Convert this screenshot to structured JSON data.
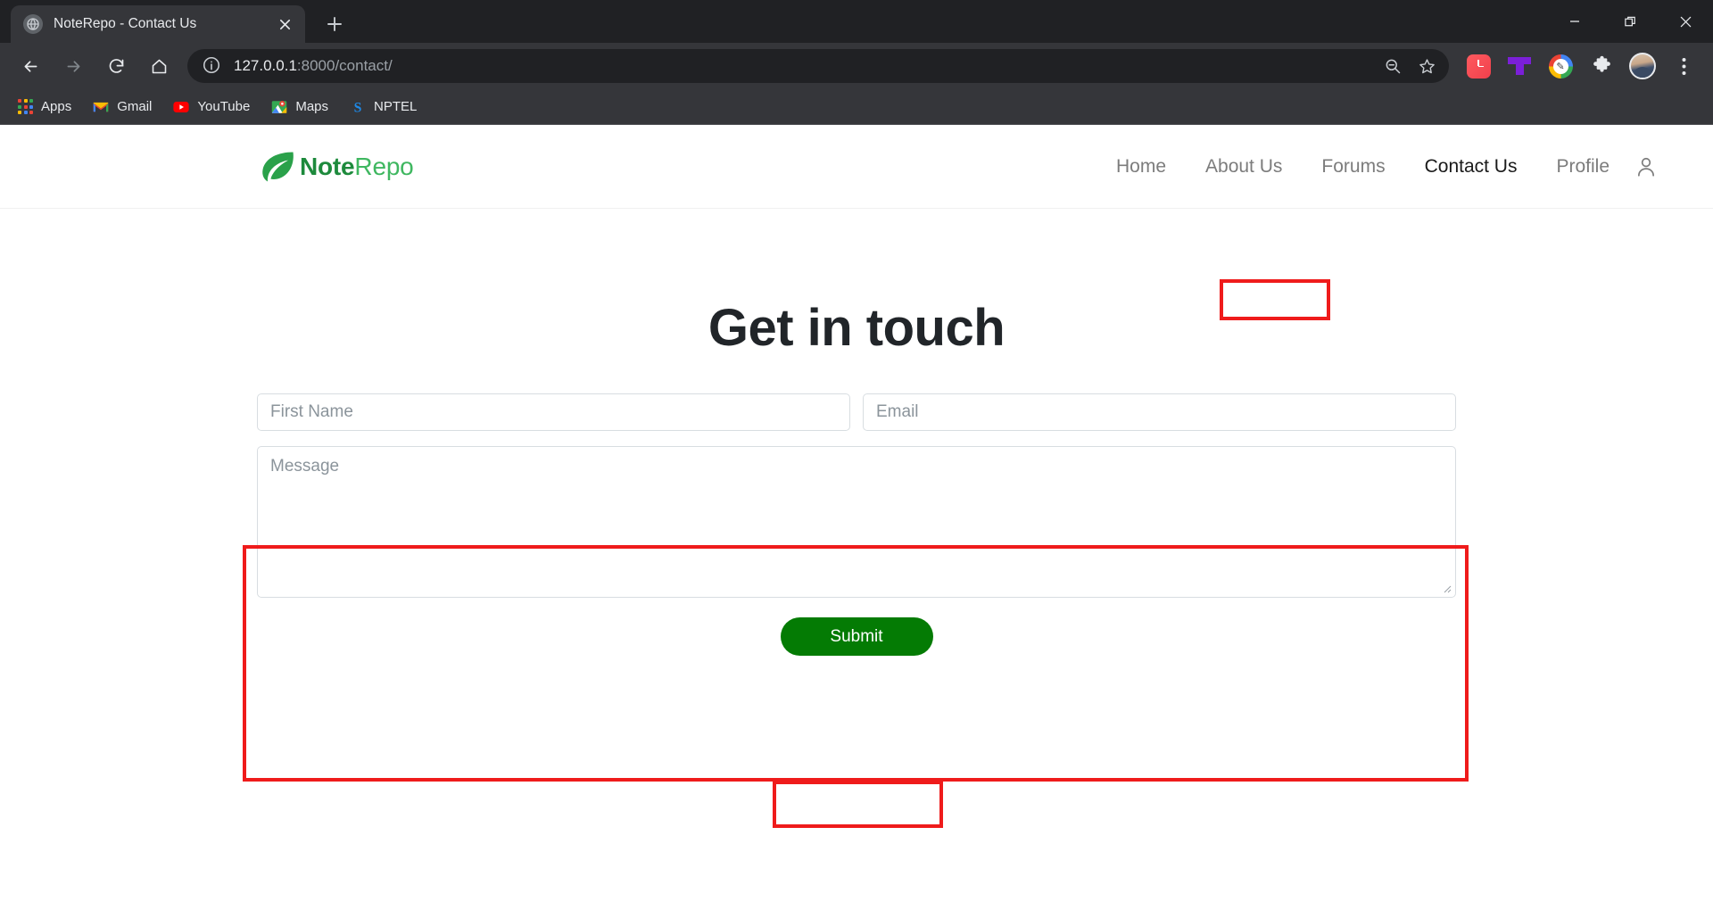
{
  "browser": {
    "tab": {
      "title": "NoteRepo - Contact Us",
      "favicon_icon": "globe-icon",
      "close_icon": "close-icon"
    },
    "new_tab_icon": "plus-icon",
    "window_controls": {
      "minimize_icon": "minimize-icon",
      "maximize_icon": "restore-window-icon",
      "close_icon": "close-icon"
    },
    "toolbar": {
      "back_icon": "back-arrow-icon",
      "forward_icon": "forward-arrow-icon",
      "reload_icon": "reload-icon",
      "home_icon": "home-icon",
      "site_info_icon": "info-circle-icon",
      "url_host": "127.0.0.1",
      "url_path": ":8000/contact/",
      "zoom_out_icon": "zoom-out-icon",
      "bookmark_icon": "star-icon",
      "extension_clock_icon": "clock-extension-icon",
      "extension_t_icon": "purple-t-extension-icon",
      "extension_pencil_icon": "google-pencil-extension-icon",
      "extensions_icon": "puzzle-piece-icon",
      "profile_avatar_icon": "avatar",
      "menu_icon": "three-dot-menu-icon"
    },
    "bookmarks": [
      {
        "label": "Apps",
        "icon": "apps-grid-icon"
      },
      {
        "label": "Gmail",
        "icon": "gmail-icon"
      },
      {
        "label": "YouTube",
        "icon": "youtube-icon"
      },
      {
        "label": "Maps",
        "icon": "google-maps-icon"
      },
      {
        "label": "NPTEL",
        "icon": "nptel-icon"
      }
    ]
  },
  "site": {
    "logo": {
      "icon": "leaf-icon",
      "text_primary": "Note",
      "text_secondary": "Repo"
    },
    "nav": [
      {
        "label": "Home",
        "active": false
      },
      {
        "label": "About Us",
        "active": false
      },
      {
        "label": "Forums",
        "active": false
      },
      {
        "label": "Contact Us",
        "active": true
      },
      {
        "label": "Profile",
        "active": false
      }
    ],
    "profile_icon": "person-icon"
  },
  "main": {
    "title": "Get in touch",
    "form": {
      "first_name_placeholder": "First Name",
      "email_placeholder": "Email",
      "message_placeholder": "Message",
      "submit_label": "Submit"
    }
  },
  "annotations": {
    "color": "#ef1b1b",
    "boxes": [
      "contact-us-nav-link",
      "contact-form",
      "submit-button"
    ]
  },
  "colors": {
    "brand_dark_green": "#1d8a3c",
    "brand_light_green": "#3fb760",
    "submit_green": "#047b04",
    "chrome_dark": "#202124",
    "chrome_toolbar": "#35363a",
    "annotation_red": "#ef1b1b",
    "heading": "#212529",
    "nav_link": "#7c7c7c"
  }
}
